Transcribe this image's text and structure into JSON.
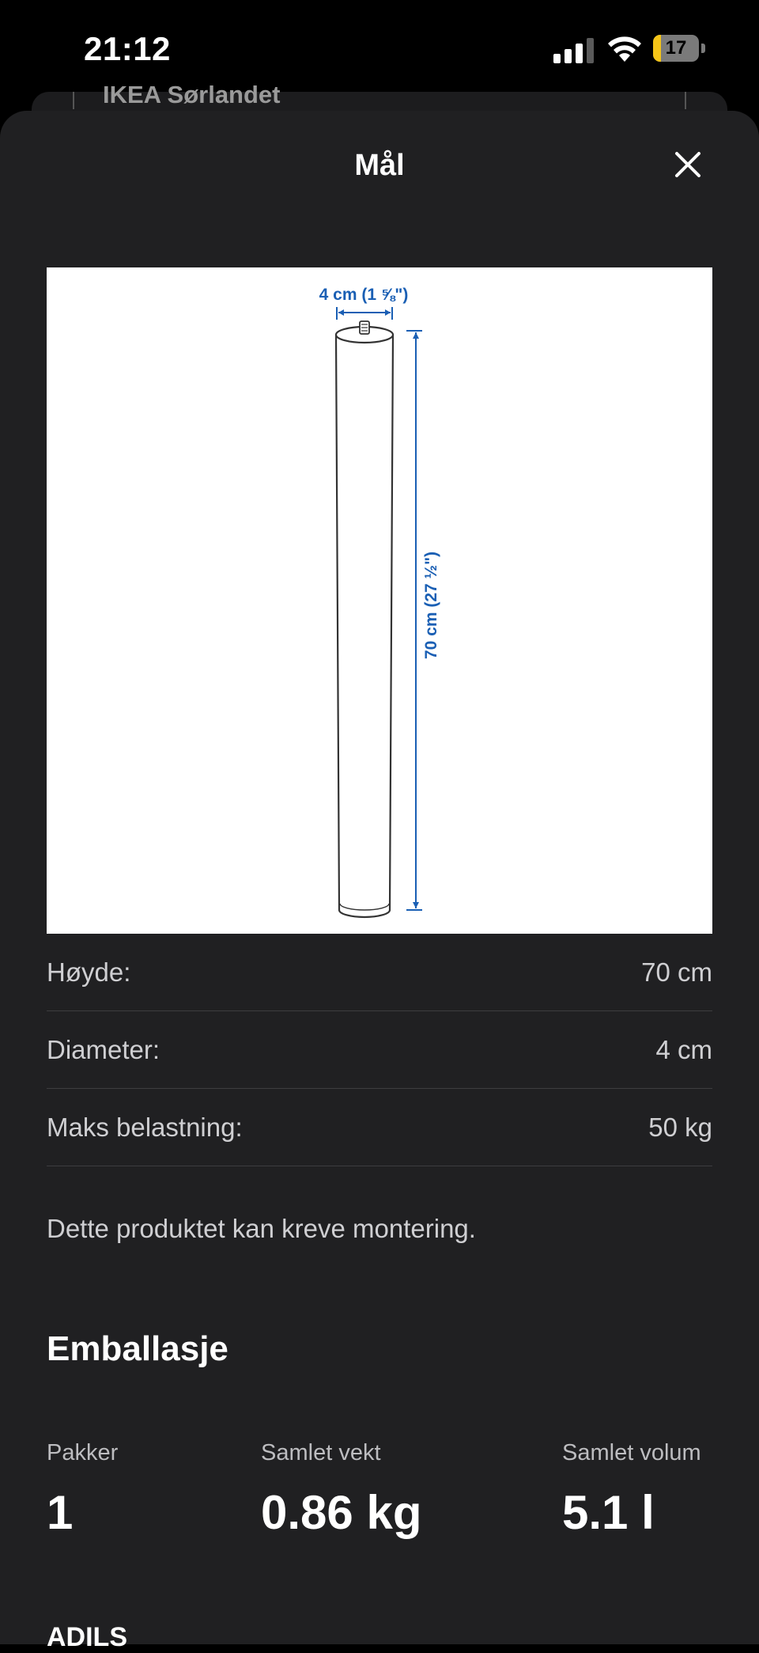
{
  "status_bar": {
    "time": "21:12",
    "battery_level": "17"
  },
  "background": {
    "store_name": "IKEA Sørlandet"
  },
  "sheet": {
    "title": "Mål"
  },
  "diagram": {
    "width_label": "4 cm (1 ⅝\")",
    "height_label": "70 cm (27 ½\")"
  },
  "specs": [
    {
      "label": "Høyde:",
      "value": "70 cm"
    },
    {
      "label": "Diameter:",
      "value": "4 cm"
    },
    {
      "label": "Maks belastning:",
      "value": "50 kg"
    }
  ],
  "note": "Dette produktet kan kreve montering.",
  "packaging": {
    "heading": "Emballasje",
    "items": [
      {
        "label": "Pakker",
        "value": "1"
      },
      {
        "label": "Samlet vekt",
        "value": "0.86 kg"
      },
      {
        "label": "Samlet volum",
        "value": "5.1 l"
      }
    ]
  },
  "next_section": {
    "title": "ADILS"
  },
  "colors": {
    "sheet_bg": "#202022",
    "dimension_blue": "#1a5fb4",
    "battery_yellow": "#f5c518"
  },
  "icons": [
    "cellular-signal-icon",
    "wifi-icon",
    "battery-icon",
    "close-icon"
  ]
}
